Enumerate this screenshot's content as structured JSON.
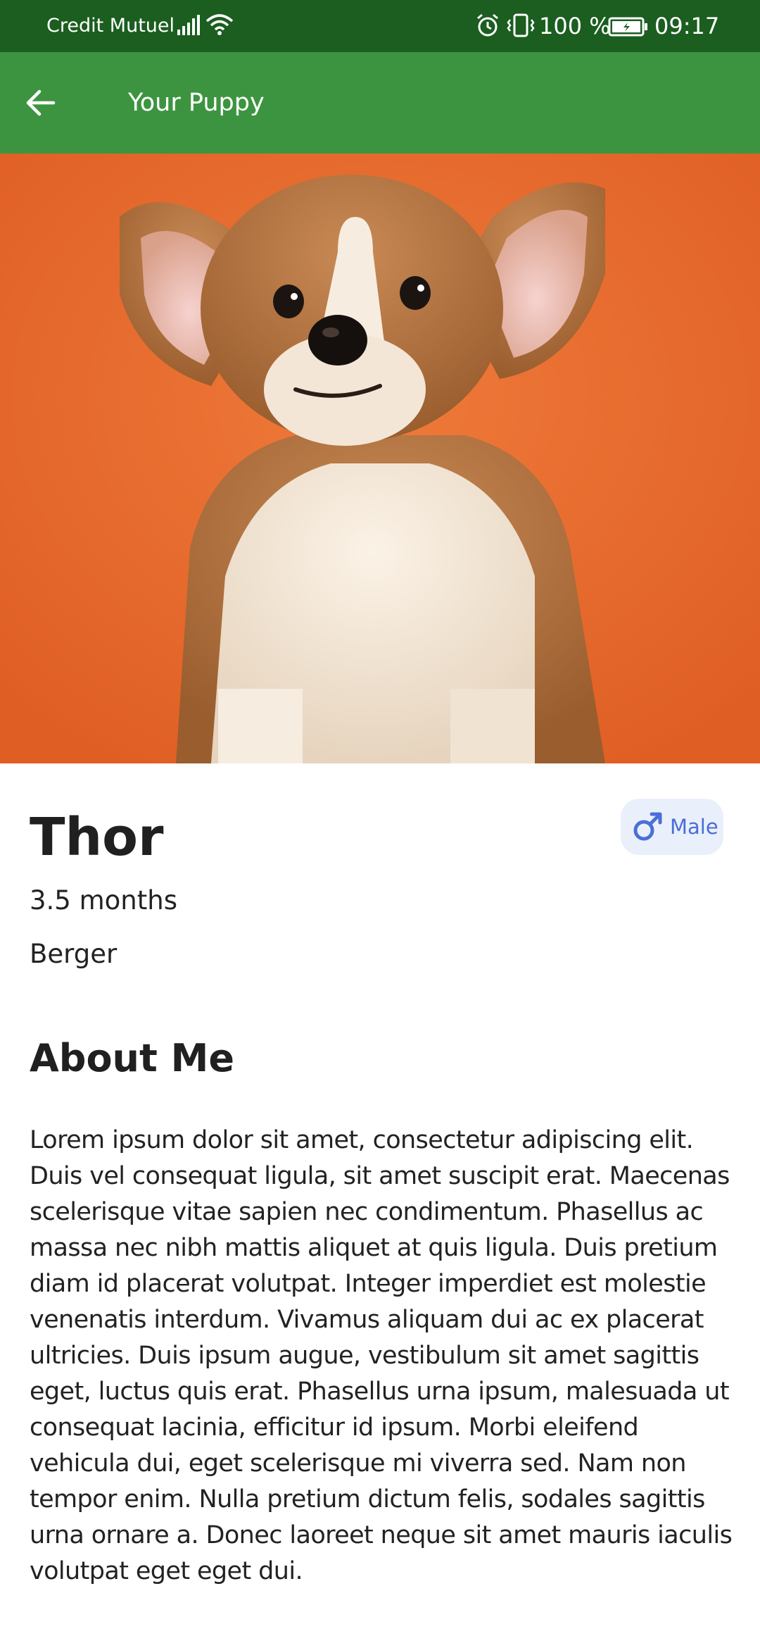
{
  "status_bar": {
    "carrier": "Credit Mutuel",
    "battery_percent": "100 %",
    "time": "09:17",
    "icons": [
      "signal-icon",
      "wifi-icon",
      "alarm-icon",
      "vibrate-icon",
      "battery-icon"
    ]
  },
  "app_bar": {
    "title": "Your Puppy",
    "back_icon": "arrow-back-icon",
    "background_color": "#3d9440"
  },
  "hero": {
    "image": "puppy-photo",
    "background_color": "#e8692c"
  },
  "puppy": {
    "name": "Thor",
    "gender": "Male",
    "gender_icon": "male-symbol-icon",
    "age": "3.5 months",
    "breed": "Berger"
  },
  "about": {
    "title": "About Me",
    "text": "Lorem ipsum dolor sit amet, consectetur adipiscing elit. Duis vel consequat ligula, sit amet suscipit erat. Maecenas scelerisque vitae sapien nec condimentum. Phasellus ac massa nec nibh mattis aliquet at quis ligula. Duis pretium diam id placerat volutpat. Integer imperdiet est molestie venenatis interdum. Vivamus aliquam dui ac ex placerat ultricies. Duis ipsum augue, vestibulum sit amet sagittis eget, luctus quis erat. Phasellus urna ipsum, malesuada ut consequat lacinia, efficitur id ipsum. Morbi eleifend vehicula dui, eget scelerisque mi viverra sed. Nam non tempor enim. Nulla pretium dictum felis, sodales sagittis urna ornare a. Donec laoreet neque sit amet mauris iaculis volutpat eget eget dui."
  },
  "colors": {
    "status_bar": "#1b5e20",
    "accent_blue": "#4a6fd6",
    "chip_bg": "#eaf0fb"
  }
}
